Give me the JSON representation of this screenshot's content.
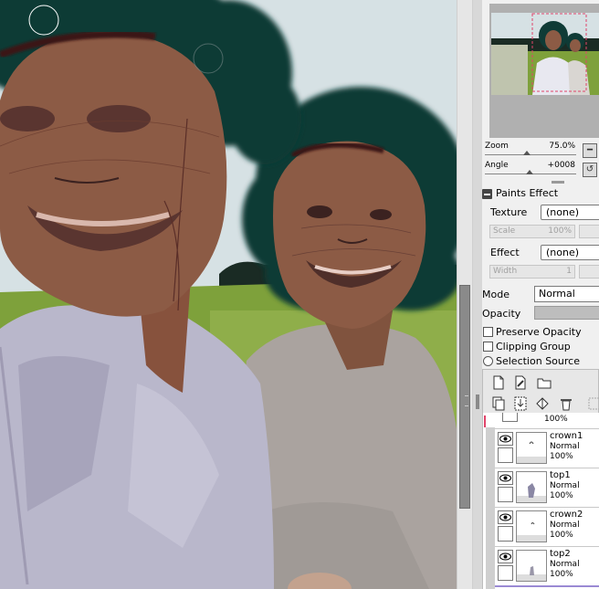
{
  "navigator": {
    "zoom_label": "Zoom",
    "zoom_value": "75.0%",
    "zoom_level": 0.75,
    "angle_label": "Angle",
    "angle_value": "+0008"
  },
  "paints_effect": {
    "title": "Paints Effect",
    "texture_label": "Texture",
    "texture_value": "(none)",
    "scale_label": "Scale",
    "scale_value": "100%",
    "effect_label": "Effect",
    "effect_value": "(none)",
    "width_label": "Width",
    "width_value": "1"
  },
  "layer_props": {
    "mode_label": "Mode",
    "mode_value": "Normal",
    "opacity_label": "Opacity",
    "preserve_opacity": "Preserve Opacity",
    "clipping_group": "Clipping Group",
    "selection_source": "Selection Source"
  },
  "layer_toolbar": {
    "icons": [
      "new-layer-icon",
      "new-linework-layer-icon",
      "new-folder-icon",
      "copy-layer-icon",
      "transfer-down-icon",
      "merge-down-icon",
      "delete-layer-icon"
    ]
  },
  "layers": {
    "partial_opacity": "100%",
    "items": [
      {
        "name": "crown1",
        "mode": "Normal",
        "opacity": "100%"
      },
      {
        "name": "top1",
        "mode": "Normal",
        "opacity": "100%"
      },
      {
        "name": "crown2",
        "mode": "Normal",
        "opacity": "100%"
      },
      {
        "name": "top2",
        "mode": "Normal",
        "opacity": "100%"
      }
    ]
  },
  "colors": {
    "sky": "#d6e1e4",
    "hair": "#0f3b36",
    "skin": "#8c5b45",
    "grass": "#7ea13b",
    "shirt": "#b9b7cb",
    "accent_layer": "#e0446a"
  }
}
